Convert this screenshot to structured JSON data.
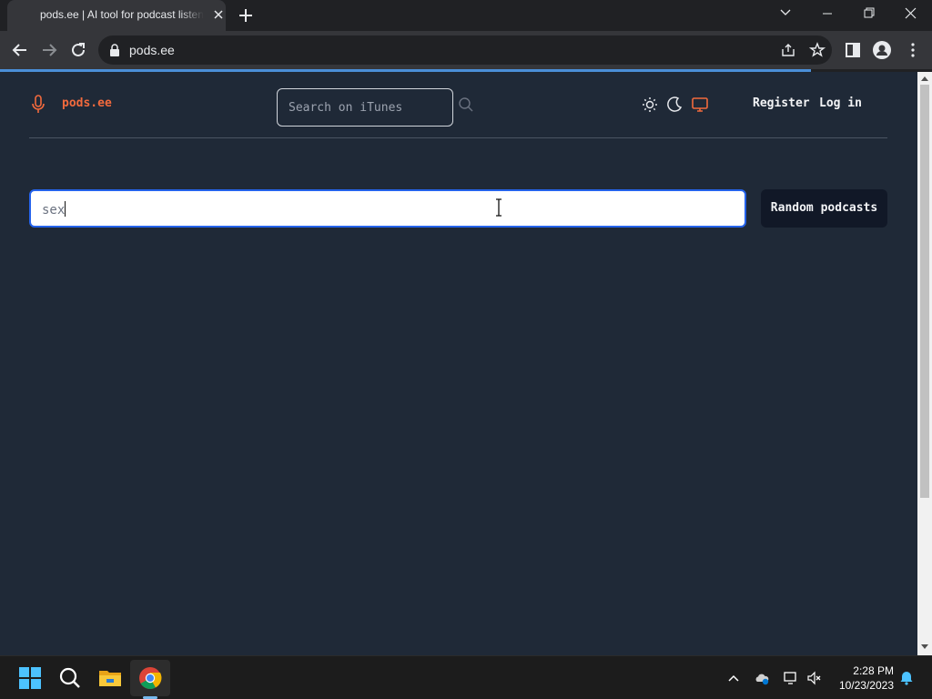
{
  "browser": {
    "tab_title": "pods.ee | AI tool for podcast listeners",
    "url": "pods.ee",
    "page_load_progress": 0.87
  },
  "site": {
    "brand": "pods.ee",
    "itunes_search_placeholder": "Search on iTunes",
    "nav": {
      "register": "Register",
      "login": "Log in"
    },
    "theme_modes": [
      "sun-icon",
      "moon-icon",
      "monitor-icon"
    ],
    "active_theme": "monitor-icon",
    "main_search_value": "sex",
    "random_button": "Random podcasts",
    "colors": {
      "accent": "#f26a3d",
      "page_bg": "#1f2937",
      "focus_ring": "#2563eb"
    }
  },
  "taskbar": {
    "apps": [
      "windows-start-icon",
      "search-icon",
      "file-explorer-icon",
      "chrome-icon"
    ],
    "time": "2:28 PM",
    "date": "10/23/2023"
  }
}
